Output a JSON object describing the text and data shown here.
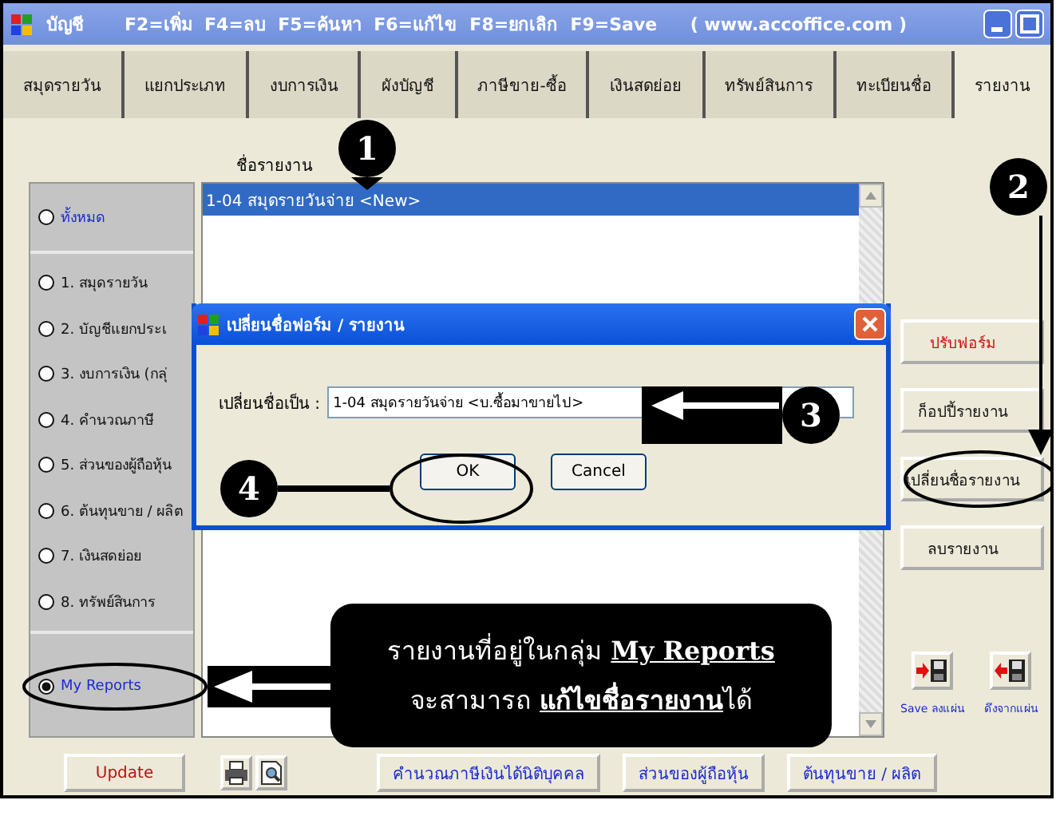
{
  "window": {
    "title": "บัญชี",
    "shortcuts": "F2=เพิ่ม  F4=ลบ  F5=ค้นหา  F6=แก้ไข  F8=ยกเลิก  F9=Save",
    "url": "( www.accoffice.com )"
  },
  "tabs": [
    {
      "label": "สมุดรายวัน",
      "selected": false
    },
    {
      "label": "แยกประเภท",
      "selected": false
    },
    {
      "label": "งบการเงิน",
      "selected": false
    },
    {
      "label": "ผังบัญชี",
      "selected": false
    },
    {
      "label": "ภาษีขาย-ซื้อ",
      "selected": false
    },
    {
      "label": "เงินสดย่อย",
      "selected": false
    },
    {
      "label": "ทรัพย์สินการ",
      "selected": false
    },
    {
      "label": "ทะเบียนชื่อ",
      "selected": false
    },
    {
      "label": "รายงาน",
      "selected": true
    }
  ],
  "report_list": {
    "label": "ชื่อรายงาน",
    "rows": [
      {
        "text": "1-04 สมุดรายวันจ่าย <New>",
        "selected": true
      }
    ]
  },
  "group_sections": [
    {
      "highlight": true,
      "items": [
        {
          "label": "ทั้งหมด",
          "selected": false
        }
      ]
    },
    {
      "highlight": false,
      "items": [
        {
          "label": "1. สมุดรายวัน",
          "selected": false
        },
        {
          "label": "2. บัญชีแยกประเ",
          "selected": false
        },
        {
          "label": "3. งบการเงิน (กลุ่",
          "selected": false
        },
        {
          "label": "4. คำนวณภาษี",
          "selected": false
        },
        {
          "label": "5. ส่วนของผู้ถือหุ้น",
          "selected": false
        },
        {
          "label": "6. ต้นทุนขาย / ผลิต",
          "selected": false
        },
        {
          "label": "7. เงินสดย่อย",
          "selected": false
        },
        {
          "label": "8. ทรัพย์สินการ",
          "selected": false
        }
      ]
    },
    {
      "highlight": true,
      "items": [
        {
          "label": "My Reports",
          "selected": true
        }
      ]
    }
  ],
  "actions": [
    {
      "label": "ปรับฟอร์ม",
      "kind": "accent"
    },
    {
      "label": "ก็อปปี้รายงาน",
      "kind": "plain"
    },
    {
      "label": "เปลี่ยนชื่อรายงาน",
      "kind": "plain"
    },
    {
      "label": "ลบรายงาน",
      "kind": "plain"
    }
  ],
  "disk_buttons": [
    {
      "label": "Save ลงแผ่น",
      "kind": "save"
    },
    {
      "label": "ดึงจากแผ่น",
      "kind": "load"
    }
  ],
  "bottom": {
    "update": "Update",
    "reports": [
      "คำนวณภาษีเงินได้นิติบุคคล",
      "ส่วนของผู้ถือหุ้น",
      "ต้นทุนขาย / ผลิต"
    ]
  },
  "dialog": {
    "title": "เปลี่ยนชื่อฟอร์ม / รายงาน",
    "field_label": "เปลี่ยนชื่อเป็น :",
    "value": "1-04 สมุดรายวันจ่าย <บ.ซื้อมาขายไป>",
    "buttons": [
      "OK",
      "Cancel"
    ]
  },
  "steps": [
    "1",
    "2",
    "3",
    "4"
  ],
  "note": {
    "lines": [
      "รายงานที่อยู่ในกลุ่ม **My Reports**",
      "จะสามารถ **แก้ไขชื่อรายงาน**ได้"
    ]
  }
}
